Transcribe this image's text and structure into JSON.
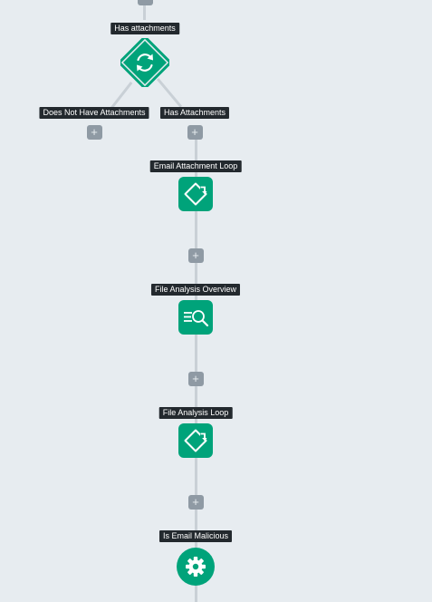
{
  "workflow": {
    "decision": {
      "label": "Has attachments",
      "icon": "refresh-icon",
      "branches": [
        {
          "label": "Does Not Have Attachments",
          "add_symbol": "+"
        },
        {
          "label": "Has Attachments",
          "add_symbol": "+"
        }
      ]
    },
    "steps": [
      {
        "label": "Email Attachment Loop",
        "icon": "loop-icon",
        "add_symbol": "+"
      },
      {
        "label": "File Analysis Overview",
        "icon": "search-list-icon",
        "add_symbol": "+"
      },
      {
        "label": "File Analysis Loop",
        "icon": "loop-icon",
        "add_symbol": "+"
      },
      {
        "label": "Is Email Malicious",
        "icon": "gear-icon"
      }
    ],
    "colors": {
      "node": "#00a37a",
      "label_bg": "#23292e",
      "connector": "#c9d0d6",
      "add_button": "#8f9aa4",
      "canvas": "#e7ecf0"
    }
  }
}
